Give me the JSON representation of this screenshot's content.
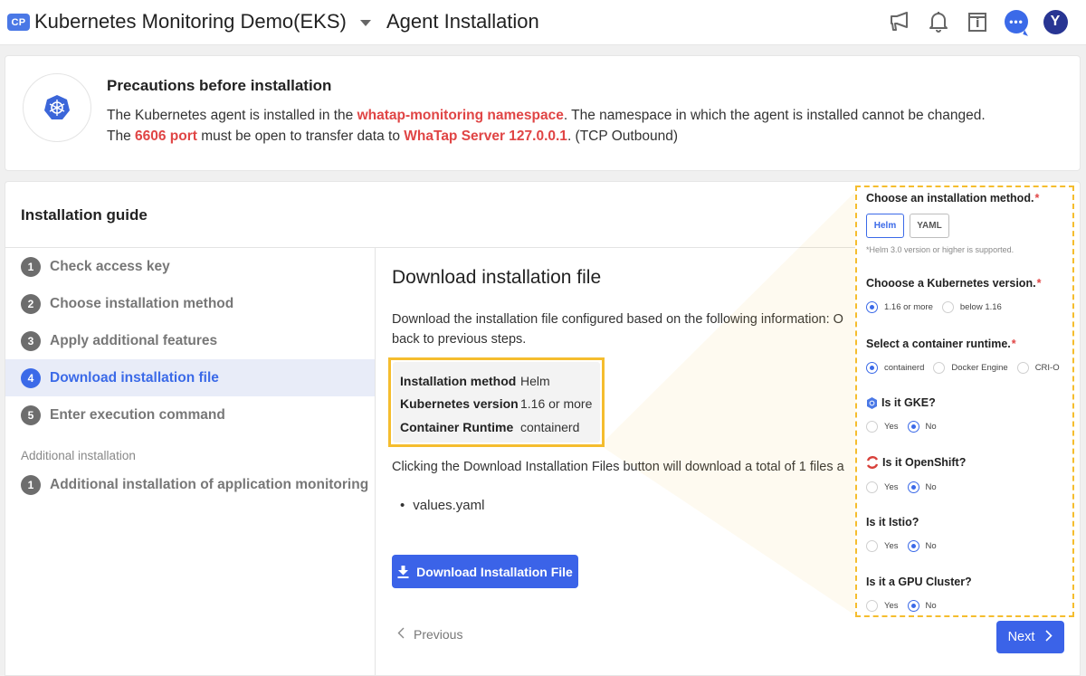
{
  "header": {
    "badge": "CP",
    "project_name": "Kubernetes Monitoring Demo(EKS)",
    "page_title": "Agent Installation",
    "icons": [
      "megaphone-icon",
      "bell-icon",
      "info-book-icon",
      "chat-icon",
      "avatar"
    ],
    "chat_glyph": "•••",
    "avatar_initial": "Y"
  },
  "precautions": {
    "title": "Precautions before installation",
    "line1": {
      "pre": "The Kubernetes agent is installed in the ",
      "highlight": "whatap-monitoring namespace",
      "post": ". The namespace in which the agent is installed cannot be changed."
    },
    "line2": {
      "pre": "The ",
      "highlight1": "6606 port",
      "mid": " must be open to transfer data to ",
      "highlight2": "WhaTap Server 127.0.0.1",
      "post": ". (TCP Outbound)"
    }
  },
  "guide": {
    "title": "Installation guide",
    "steps": [
      {
        "num": "1",
        "label": "Check access key"
      },
      {
        "num": "2",
        "label": "Choose installation method"
      },
      {
        "num": "3",
        "label": "Apply additional features"
      },
      {
        "num": "4",
        "label": "Download installation file",
        "active": true
      },
      {
        "num": "5",
        "label": "Enter execution command"
      }
    ],
    "additional_label": "Additional installation",
    "additional_steps": [
      {
        "num": "1",
        "label": "Additional installation of application monitoring"
      }
    ]
  },
  "content": {
    "title": "Download installation file",
    "desc_line1": "Download the installation file configured based on the following information: O",
    "desc_line2": "back to previous steps.",
    "summary": [
      {
        "key": "Installation method",
        "value": "Helm"
      },
      {
        "key": "Kubernetes version",
        "value": "1.16 or more"
      },
      {
        "key": "Container Runtime",
        "value": "containerd"
      }
    ],
    "download_desc": "Clicking the Download Installation Files button will download a total of 1 files a",
    "files": [
      "values.yaml"
    ],
    "download_button": "Download Installation File",
    "previous_button": "Previous",
    "next_button": "Next"
  },
  "callout": {
    "method": {
      "title": "Choose an installation method.",
      "required": "*",
      "options": [
        "Helm",
        "YAML"
      ],
      "selected": "Helm",
      "note": "*Helm 3.0 version or higher is supported."
    },
    "k8s_version": {
      "title": "Chooose a Kubernetes version.",
      "required": "*",
      "options": [
        "1.16 or more",
        "below 1.16"
      ],
      "selected": "1.16 or more"
    },
    "runtime": {
      "title": "Select a container runtime.",
      "required": "*",
      "options": [
        "containerd",
        "Docker Engine",
        "CRI-O"
      ],
      "selected": "containerd"
    },
    "gke": {
      "title": "Is it GKE?",
      "options": [
        "Yes",
        "No"
      ],
      "selected": "No"
    },
    "openshift": {
      "title": "Is it OpenShift?",
      "options": [
        "Yes",
        "No"
      ],
      "selected": "No"
    },
    "istio": {
      "title": "Is it Istio?",
      "options": [
        "Yes",
        "No"
      ],
      "selected": "No"
    },
    "gpu": {
      "title": "Is it a GPU Cluster?",
      "options": [
        "Yes",
        "No"
      ],
      "selected": "No"
    }
  },
  "colors": {
    "accent": "#3b6ae8",
    "highlight_red": "#e04545",
    "callout_border": "#f5bd2e",
    "active_step_bg": "#e8ecf8"
  }
}
